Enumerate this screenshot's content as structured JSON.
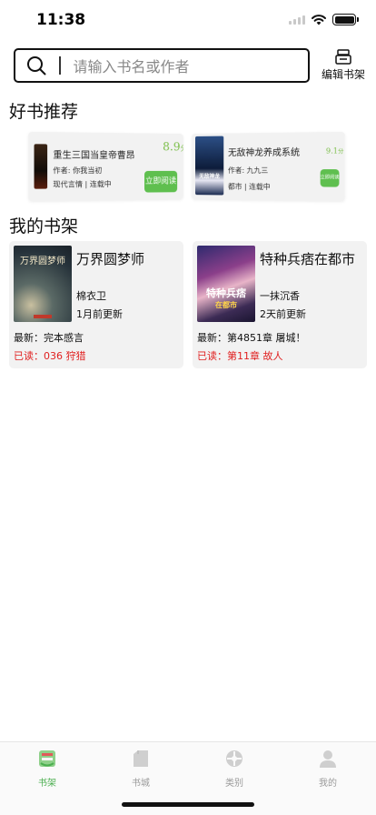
{
  "status_bar": {
    "time": "11:38"
  },
  "search": {
    "placeholder": "请输入书名或作者"
  },
  "header": {
    "edit_shelf_label": "编辑书架"
  },
  "sections": {
    "recommend_title": "好书推荐",
    "shelf_title": "我的书架"
  },
  "recommendations": [
    {
      "title": "重生三国当皇帝曹昂",
      "author": "作者: 你我当初",
      "tags": "现代言情 | 连载中",
      "score": "8.9",
      "score_unit": "分",
      "button_label": "立即阅读"
    },
    {
      "title": "无敌神龙养成系统",
      "author": "作者: 九九三",
      "tags": "都市 | 连载中",
      "score": "9.1",
      "score_unit": "分",
      "button_label": "立即阅读",
      "cover_text": "无敌神龙"
    }
  ],
  "shelf": [
    {
      "title": "万界圆梦师",
      "author": "棉衣卫",
      "update": "1月前更新",
      "latest": "最新：完本感言",
      "read": "已读：036 狩猎",
      "cover_text": "万界圆梦师"
    },
    {
      "title": "特种兵痞在都市",
      "author": "一抹沉香",
      "update": "2天前更新",
      "latest": "最新：第4851章 屠城！",
      "read": "已读：第11章 故人",
      "cover_text": "特种兵痞",
      "cover_subtext": "在都市"
    }
  ],
  "tabs": [
    {
      "label": "书架",
      "icon": "bookshelf-icon",
      "active": true
    },
    {
      "label": "书城",
      "icon": "bookstore-icon",
      "active": false
    },
    {
      "label": "类别",
      "icon": "category-icon",
      "active": false
    },
    {
      "label": "我的",
      "icon": "profile-icon",
      "active": false
    }
  ],
  "colors": {
    "accent_green": "#5fbf4f",
    "read_red": "#e02020",
    "score_green": "#7cbf4a"
  }
}
